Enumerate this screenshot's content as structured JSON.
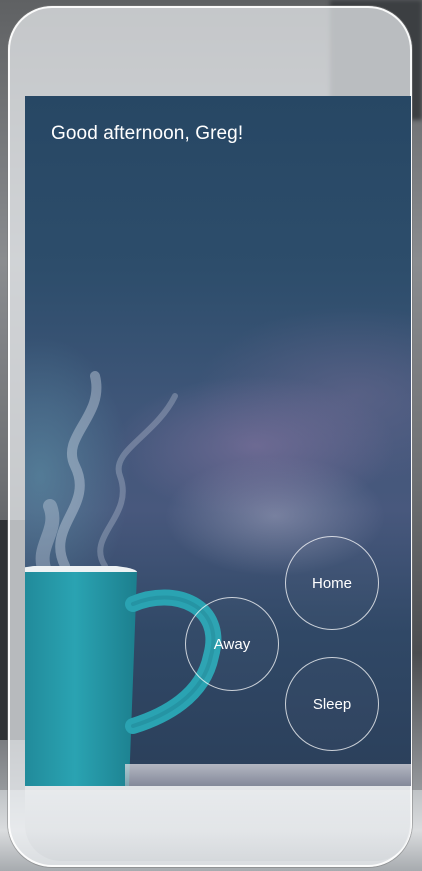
{
  "screen": {
    "greeting": "Good afternoon, Greg!"
  },
  "modes": [
    {
      "label": "Home"
    },
    {
      "label": "Away"
    },
    {
      "label": "Sleep"
    }
  ],
  "colors": {
    "screen_top": "#274764",
    "screen_mid": "#48587d",
    "mug": "#2a9fae",
    "button_border": "#ffffff"
  }
}
